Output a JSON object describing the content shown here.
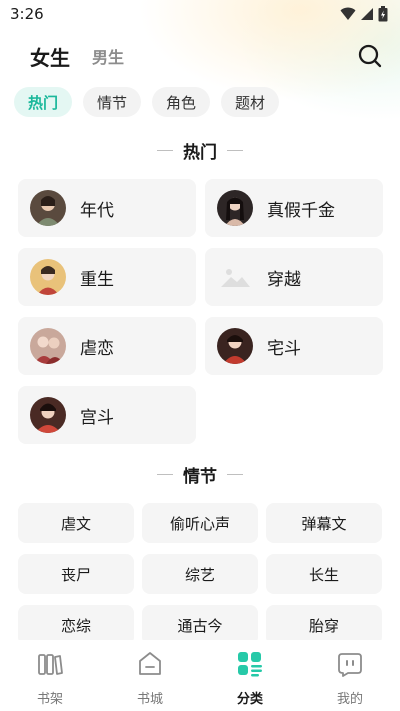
{
  "status": {
    "time": "3:26"
  },
  "header": {
    "tabs": [
      {
        "label": "女生",
        "active": true
      },
      {
        "label": "男生",
        "active": false
      }
    ]
  },
  "chips": [
    {
      "label": "热门",
      "active": true
    },
    {
      "label": "情节",
      "active": false
    },
    {
      "label": "角色",
      "active": false
    },
    {
      "label": "题材",
      "active": false
    }
  ],
  "sections": {
    "hot": {
      "title": "热门",
      "items": [
        {
          "label": "年代",
          "icon": "period-portrait-avatar"
        },
        {
          "label": "真假千金",
          "icon": "lady-portrait-avatar"
        },
        {
          "label": "重生",
          "icon": "rebirth-portrait-avatar"
        },
        {
          "label": "穿越",
          "icon": "image-placeholder-icon"
        },
        {
          "label": "虐恋",
          "icon": "romance-portrait-avatar"
        },
        {
          "label": "宅斗",
          "icon": "mansion-portrait-avatar"
        },
        {
          "label": "宫斗",
          "icon": "palace-portrait-avatar"
        }
      ]
    },
    "plot": {
      "title": "情节",
      "items": [
        "虐文",
        "偷听心声",
        "弹幕文",
        "丧尸",
        "综艺",
        "长生",
        "恋综",
        "通古今",
        "胎穿"
      ]
    }
  },
  "bottom_nav": [
    {
      "label": "书架",
      "icon": "bookshelf-icon",
      "active": false
    },
    {
      "label": "书城",
      "icon": "bookstore-icon",
      "active": false
    },
    {
      "label": "分类",
      "icon": "category-icon",
      "active": true
    },
    {
      "label": "我的",
      "icon": "profile-icon",
      "active": false
    }
  ],
  "colors": {
    "accent": "#1bb89b",
    "chip_active_bg": "#e4f7f3",
    "card_bg": "#f5f5f5"
  }
}
